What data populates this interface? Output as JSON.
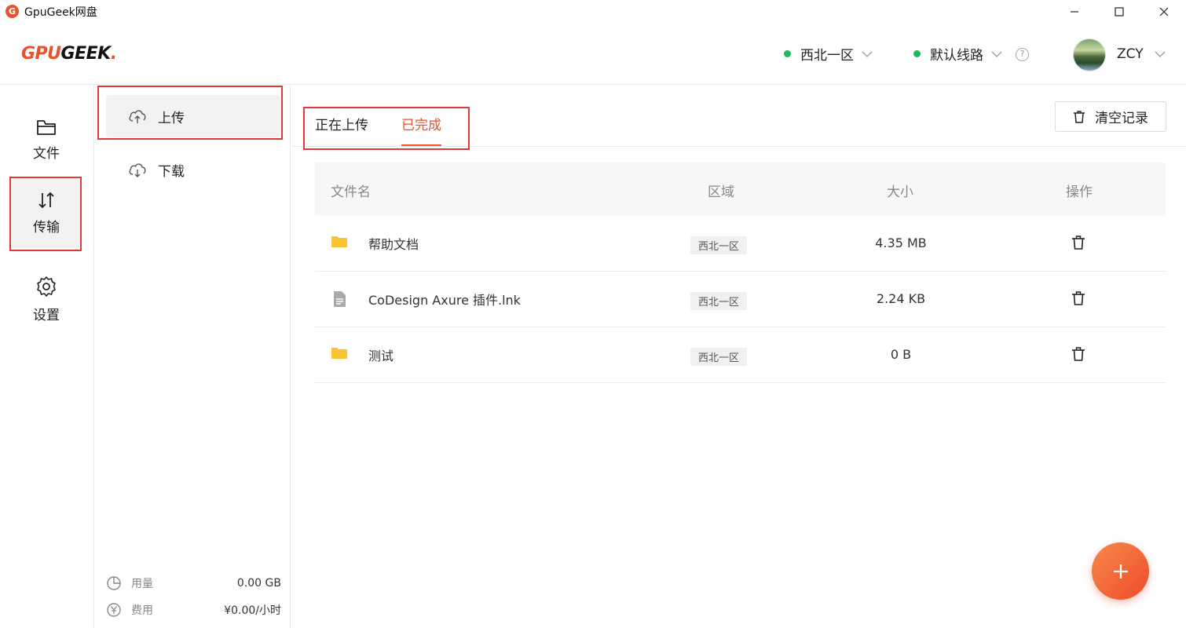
{
  "window": {
    "title": "GpuGeek网盘",
    "app_icon_letter": "G"
  },
  "header": {
    "logo_main": "GPU",
    "logo_accent": "GEEK",
    "logo_dot": ".",
    "region": "西北一区",
    "route": "默认线路",
    "help_glyph": "?",
    "user": "ZCY"
  },
  "nav": {
    "items": [
      {
        "label": "文件",
        "icon": "folder-icon"
      },
      {
        "label": "传输",
        "icon": "transfer-icon"
      },
      {
        "label": "设置",
        "icon": "gear-icon"
      }
    ],
    "active": "传输"
  },
  "sidebar": {
    "items": [
      {
        "label": "上传",
        "icon": "cloud-upload-icon"
      },
      {
        "label": "下载",
        "icon": "cloud-download-icon"
      }
    ],
    "active": "上传",
    "usage": {
      "label": "用量",
      "value": "0.00 GB"
    },
    "fee": {
      "label": "费用",
      "value": "¥0.00/小时"
    }
  },
  "main": {
    "tabs": [
      {
        "label": "正在上传"
      },
      {
        "label": "已完成"
      }
    ],
    "active_tab": "已完成",
    "clear_button": "清空记录",
    "table": {
      "headers": {
        "name": "文件名",
        "region": "区域",
        "size": "大小",
        "action": "操作"
      },
      "rows": [
        {
          "name": "帮助文档",
          "type": "folder",
          "region": "西北一区",
          "size": "4.35 MB"
        },
        {
          "name": "CoDesign Axure 插件.lnk",
          "type": "file",
          "region": "西北一区",
          "size": "2.24 KB"
        },
        {
          "name": "测试",
          "type": "folder",
          "region": "西北一区",
          "size": "0 B"
        }
      ]
    },
    "fab": "+"
  },
  "colors": {
    "accent": "#e8532e",
    "status_green": "#1fb95a",
    "folder_yellow": "#f8c233",
    "annotation_red": "#e0393b"
  }
}
